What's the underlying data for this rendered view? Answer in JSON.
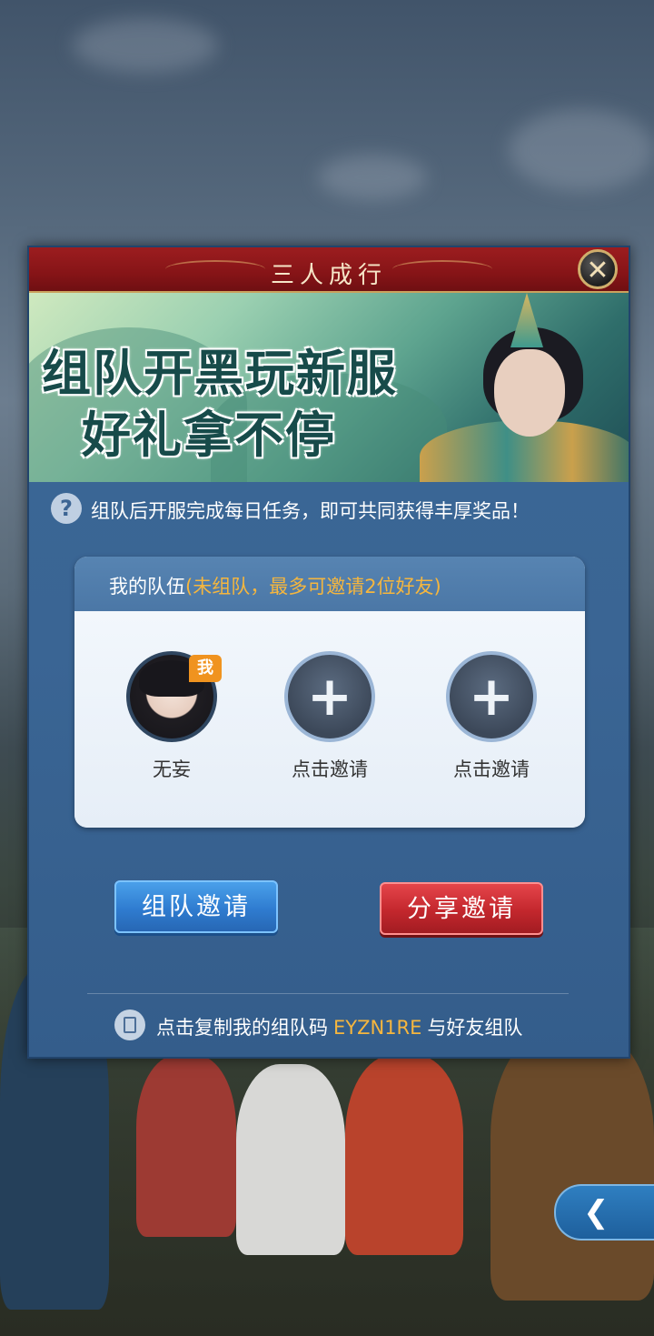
{
  "dialog": {
    "title": "三人成行",
    "close_glyph": "✕",
    "banner": {
      "line1": "组队开黑玩新服",
      "line2": "好礼拿不停"
    },
    "tip": {
      "icon": "?",
      "text": "组队后开服完成每日任务，即可共同获得丰厚奖品！"
    },
    "team": {
      "title": "我的队伍",
      "note": "(未组队，最多可邀请2位好友)",
      "members": [
        {
          "name": "无妄",
          "badge": "我"
        },
        {
          "label": "点击邀请"
        },
        {
          "label": "点击邀请"
        }
      ],
      "add_glyph": "+"
    },
    "buttons": {
      "team_invite": "组队邀请",
      "share_invite": "分享邀请"
    },
    "copy": {
      "prefix": "点击复制我的组队码",
      "code": "EYZN1RE",
      "suffix": "与好友组队"
    }
  },
  "side_tab": {
    "glyph": "❮"
  },
  "colors": {
    "title_red": "#861417",
    "panel_blue": "#3a6594",
    "accent_orange": "#f5b63e",
    "blue_button": "#2f7cd0",
    "red_button": "#c3272d"
  }
}
